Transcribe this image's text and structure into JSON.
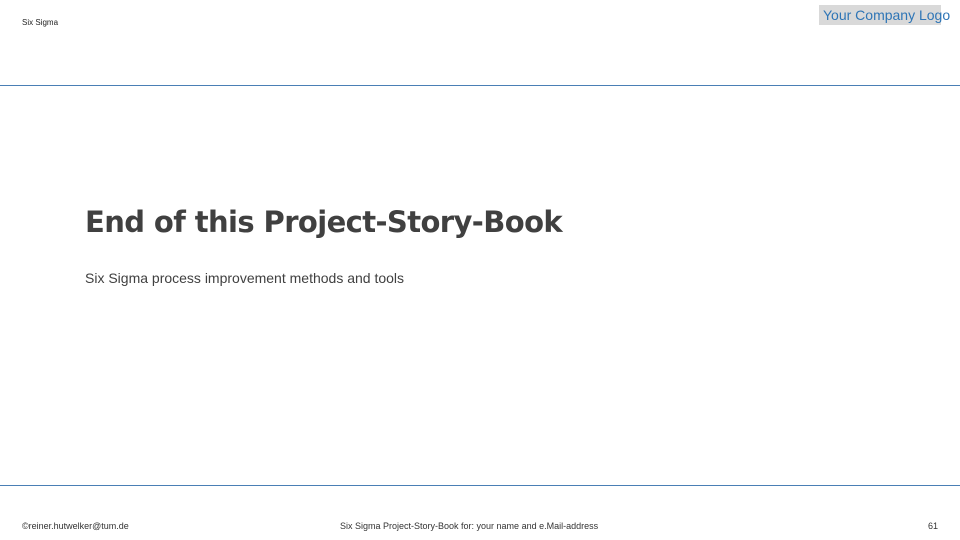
{
  "header": {
    "section_label": "Six Sigma",
    "logo_text": "Your Company Logo"
  },
  "main": {
    "title": "End of this Project-Story-Book",
    "subtitle": "Six Sigma process improvement methods and tools"
  },
  "footer": {
    "author": "©reiner.hutwelker@tum.de",
    "book_label": "Six Sigma Project-Story-Book for: your name and e.Mail-address",
    "page_number": "61"
  },
  "colors": {
    "accent": "#2e75b6",
    "rule": "#4a7fb5",
    "logo_background": "#d9d9d9",
    "text": "#404040"
  }
}
